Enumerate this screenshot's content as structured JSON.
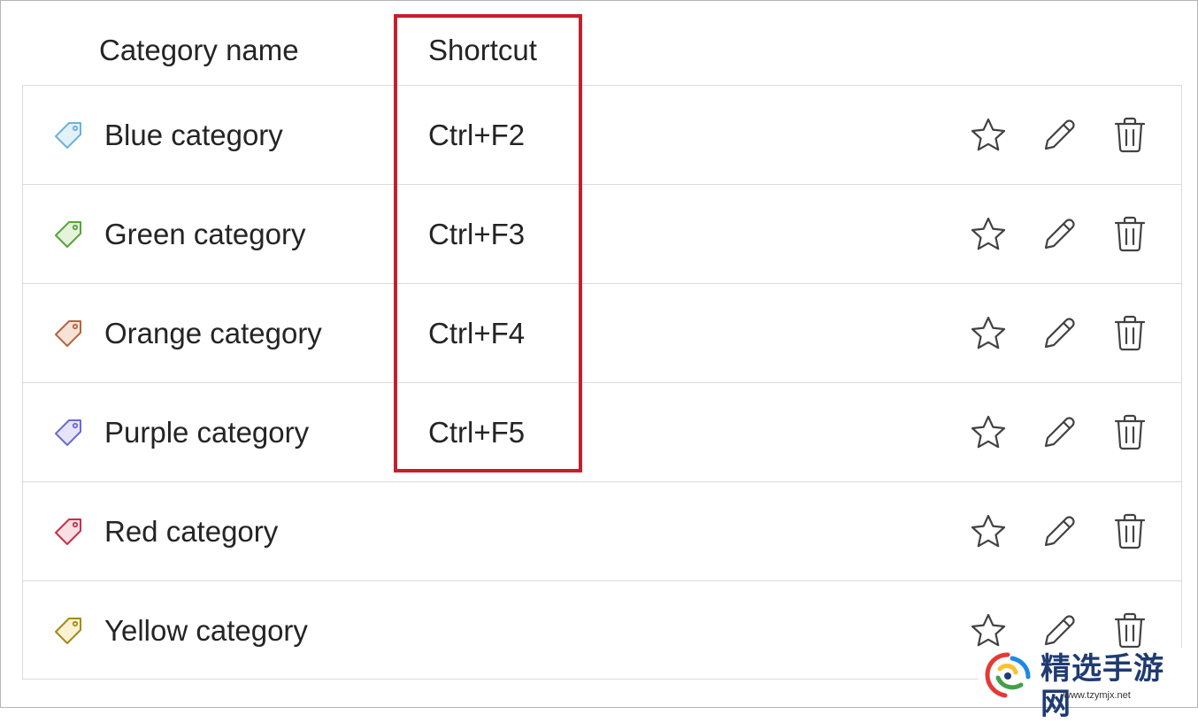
{
  "headers": {
    "name": "Category name",
    "shortcut": "Shortcut"
  },
  "rows": [
    {
      "name": "Blue category",
      "shortcut": "Ctrl+F2",
      "color": "#6cb2d9",
      "fill": "#e3f1f9"
    },
    {
      "name": "Green category",
      "shortcut": "Ctrl+F3",
      "color": "#5aa339",
      "fill": "#e4f3dc"
    },
    {
      "name": "Orange category",
      "shortcut": "Ctrl+F4",
      "color": "#b0663f",
      "fill": "#f7e2d7"
    },
    {
      "name": "Purple category",
      "shortcut": "Ctrl+F5",
      "color": "#6b6bd1",
      "fill": "#e6e4fa"
    },
    {
      "name": "Red category",
      "shortcut": "",
      "color": "#c4314b",
      "fill": "#f8dfe3"
    },
    {
      "name": "Yellow category",
      "shortcut": "",
      "color": "#a48a1a",
      "fill": "#faf3d3"
    }
  ],
  "icons": {
    "tag": "tag-icon",
    "favorite": "star-icon",
    "edit": "pencil-icon",
    "delete": "trash-icon"
  },
  "highlight_color": "#c4202c",
  "watermark": {
    "text": "精选手游网",
    "url": "www.tzymjx.net"
  }
}
